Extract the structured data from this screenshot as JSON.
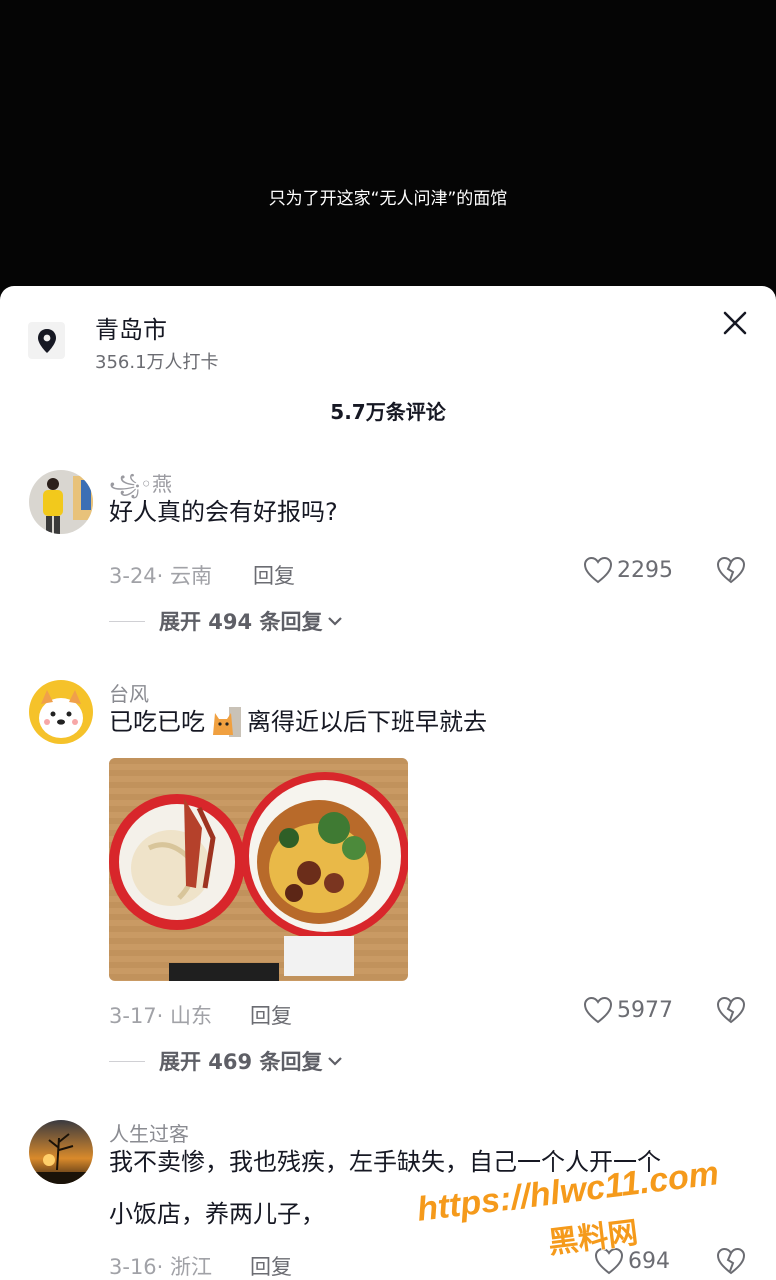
{
  "video": {
    "subtitle": "只为了开这家“无人问津”的面馆"
  },
  "location": {
    "city": "青岛市",
    "checkins": "356.1万人打卡"
  },
  "comment_count": "5.7万条评论",
  "comments": [
    {
      "username": "꧁◦燕",
      "text": "好人真的会有好报吗?",
      "date_region": "3-24· 云南",
      "reply_label": "回复",
      "likes": "2295",
      "expand_label": "展开 494 条回复"
    },
    {
      "username": "台风",
      "text_before": "已吃已吃",
      "text_after": "离得近以后下班早就去",
      "date_region": "3-17· 山东",
      "reply_label": "回复",
      "likes": "5977",
      "expand_label": "展开 469 条回复"
    },
    {
      "username": "人生过客",
      "text": "我不卖惨，我也残疾，左手缺失，自己一个人开一个小饭店，养两儿子，",
      "date_region": "3-16· 浙江",
      "reply_label": "回复",
      "likes": "694"
    }
  ],
  "watermark": {
    "line1": "https://hlwc11.com",
    "line2": "黑料网"
  },
  "colors": {
    "text_primary": "#161823",
    "text_secondary": "#8a8b91",
    "watermark_orange": "#f59a1b"
  }
}
